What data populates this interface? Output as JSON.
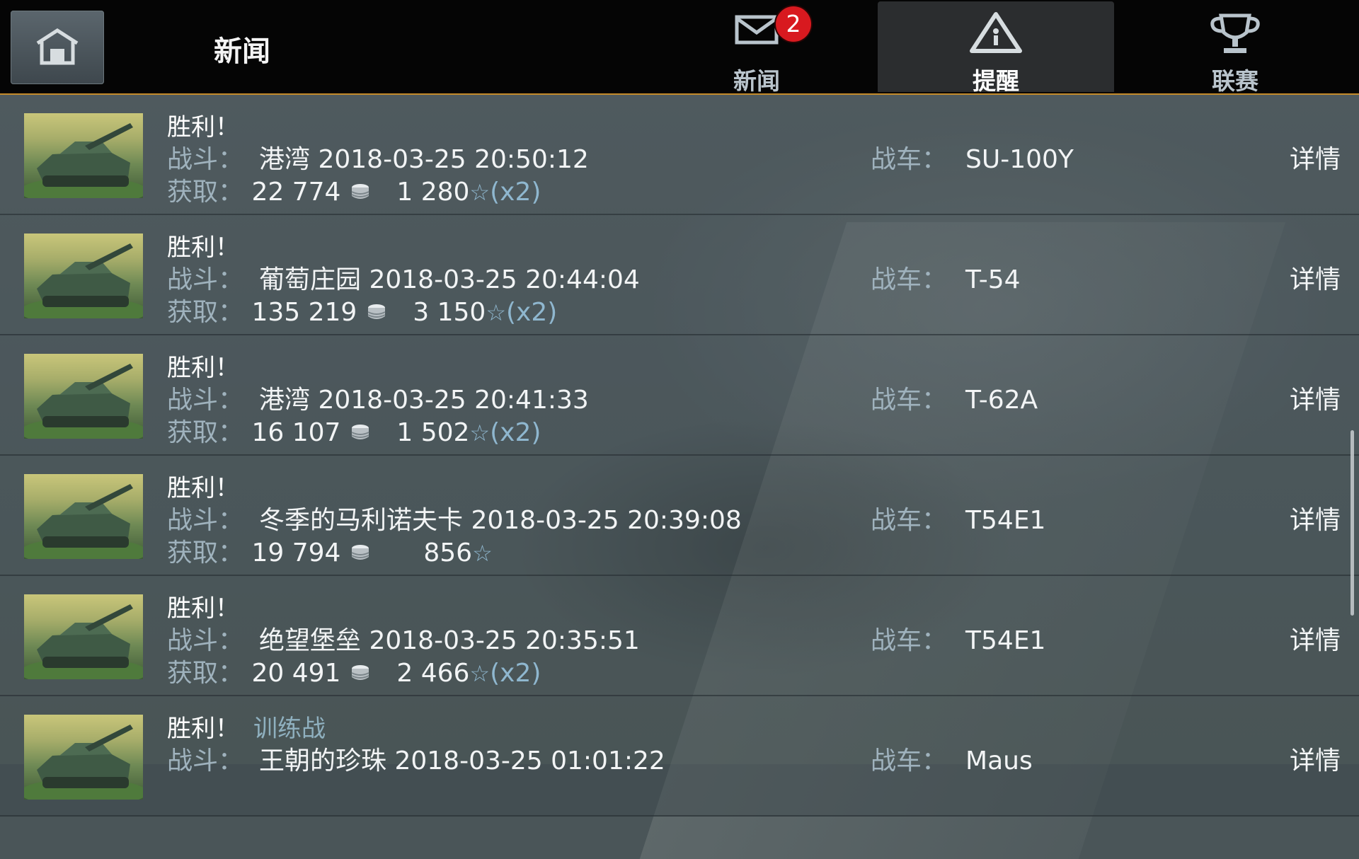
{
  "header": {
    "page_title": "新闻",
    "tabs": [
      {
        "label": "新闻",
        "icon": "mail-icon",
        "badge": "2"
      },
      {
        "label": "提醒",
        "icon": "warning-icon",
        "active": true
      },
      {
        "label": "联赛",
        "icon": "trophy-icon"
      }
    ]
  },
  "labels": {
    "battle": "战斗：",
    "earned": "获取：",
    "tank": "战车：",
    "details": "详情"
  },
  "battles": [
    {
      "result": "胜利！",
      "mode": "",
      "map_time": "港湾 2018-03-25 20:50:12",
      "credits": "22 774",
      "xp": "1 280",
      "multiplier": "(x2)",
      "tank": "SU-100Y"
    },
    {
      "result": "胜利！",
      "mode": "",
      "map_time": "葡萄庄园 2018-03-25 20:44:04",
      "credits": "135 219",
      "xp": "3 150",
      "multiplier": "(x2)",
      "tank": "T-54"
    },
    {
      "result": "胜利！",
      "mode": "",
      "map_time": "港湾 2018-03-25 20:41:33",
      "credits": "16 107",
      "xp": "1 502",
      "multiplier": "(x2)",
      "tank": "T-62A"
    },
    {
      "result": "胜利！",
      "mode": "",
      "map_time": "冬季的马利诺夫卡 2018-03-25 20:39:08",
      "credits": "19 794",
      "xp": "856",
      "multiplier": "",
      "tank": "T54E1"
    },
    {
      "result": "胜利！",
      "mode": "",
      "map_time": "绝望堡垒 2018-03-25 20:35:51",
      "credits": "20 491",
      "xp": "2 466",
      "multiplier": "(x2)",
      "tank": "T54E1"
    },
    {
      "result": "胜利！",
      "mode": "训练战",
      "map_time": "王朝的珍珠 2018-03-25 01:01:22",
      "credits": "",
      "xp": "",
      "multiplier": "",
      "tank": "Maus"
    }
  ],
  "colors": {
    "accent_border": "#c58b2a",
    "badge": "#d8191f",
    "label": "#9fb2bd",
    "xp_blue": "#8fb7cf"
  }
}
